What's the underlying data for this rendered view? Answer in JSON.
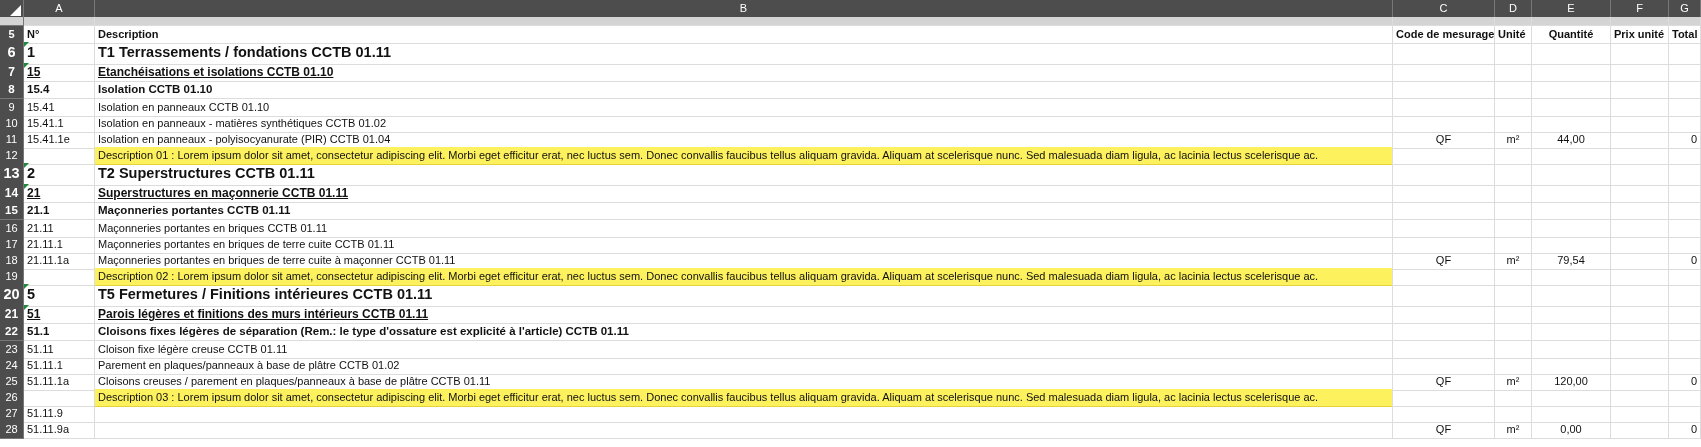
{
  "columns": [
    {
      "letter": "A"
    },
    {
      "letter": "B"
    },
    {
      "letter": "C"
    },
    {
      "letter": "D"
    },
    {
      "letter": "E"
    },
    {
      "letter": "F"
    },
    {
      "letter": "G"
    }
  ],
  "rows": [
    {
      "kind": "spacer",
      "marked": false
    },
    {
      "number": "5",
      "kind": "header",
      "marked": false,
      "no": "N°",
      "description": "Description",
      "code": "Code de mesurage",
      "unit": "Unité",
      "quantity": "Quantité",
      "unit_price": "Prix unité",
      "total": "Total"
    },
    {
      "number": "6",
      "kind": "section",
      "marked": true,
      "no": "1",
      "description": "T1 Terrassements / fondations CCTB 01.11"
    },
    {
      "number": "7",
      "kind": "subsection",
      "marked": true,
      "no": "15",
      "description": "Etanchéisations et isolations CCTB 01.10"
    },
    {
      "number": "8",
      "kind": "group",
      "marked": false,
      "no": "15.4",
      "description": "Isolation CCTB 01.10"
    },
    {
      "number": "9",
      "kind": "item",
      "marked": false,
      "no": "15.41",
      "description": "Isolation en panneaux CCTB 01.10"
    },
    {
      "number": "10",
      "kind": "item",
      "marked": false,
      "no": "15.41.1",
      "description": "Isolation en panneaux - matières synthétiques CCTB 01.02"
    },
    {
      "number": "11",
      "kind": "item",
      "marked": false,
      "no": "15.41.1e",
      "description": "Isolation en panneaux - polyisocyanurate (PIR) CCTB 01.04",
      "code": "QF",
      "unit": "m²",
      "quantity": "44,00",
      "total": "0"
    },
    {
      "number": "12",
      "kind": "description",
      "marked": false,
      "description": "Description 01 : Lorem ipsum dolor sit amet, consectetur adipiscing elit. Morbi eget efficitur erat, nec luctus sem. Donec convallis faucibus tellus aliquam gravida. Aliquam at scelerisque nunc. Sed malesuada diam ligula, ac lacinia lectus scelerisque ac."
    },
    {
      "number": "13",
      "kind": "section",
      "marked": true,
      "no": "2",
      "description": "T2 Superstructures CCTB 01.11"
    },
    {
      "number": "14",
      "kind": "subsection",
      "marked": true,
      "no": "21",
      "description": "Superstructures en maçonnerie CCTB 01.11"
    },
    {
      "number": "15",
      "kind": "group",
      "marked": false,
      "no": "21.1",
      "description": "Maçonneries portantes CCTB 01.11"
    },
    {
      "number": "16",
      "kind": "item",
      "marked": false,
      "no": "21.11",
      "description": "Maçonneries portantes en briques CCTB 01.11"
    },
    {
      "number": "17",
      "kind": "item",
      "marked": false,
      "no": "21.11.1",
      "description": "Maçonneries portantes en briques de terre cuite CCTB 01.11"
    },
    {
      "number": "18",
      "kind": "item",
      "marked": false,
      "no": "21.11.1a",
      "description": "Maçonneries portantes en briques de terre cuite à maçonner CCTB 01.11",
      "code": "QF",
      "unit": "m²",
      "quantity": "79,54",
      "total": "0"
    },
    {
      "number": "19",
      "kind": "description",
      "marked": false,
      "description": "Description 02 : Lorem ipsum dolor sit amet, consectetur adipiscing elit. Morbi eget efficitur erat, nec luctus sem. Donec convallis faucibus tellus aliquam gravida. Aliquam at scelerisque nunc. Sed malesuada diam ligula, ac lacinia lectus scelerisque ac."
    },
    {
      "number": "20",
      "kind": "section",
      "marked": true,
      "no": "5",
      "description": "T5 Fermetures / Finitions intérieures CCTB 01.11"
    },
    {
      "number": "21",
      "kind": "subsection",
      "marked": true,
      "no": "51",
      "description": "Parois légères et finitions des murs intérieurs CCTB 01.11"
    },
    {
      "number": "22",
      "kind": "group",
      "marked": false,
      "no": "51.1",
      "description": "Cloisons fixes légères de séparation (Rem.: le type d'ossature est explicité à l'article) CCTB 01.11"
    },
    {
      "number": "23",
      "kind": "item",
      "marked": false,
      "no": "51.11",
      "description": "Cloison fixe légère creuse CCTB 01.11"
    },
    {
      "number": "24",
      "kind": "item",
      "marked": false,
      "no": "51.11.1",
      "description": "Parement en plaques/panneaux à base de plâtre CCTB 01.02"
    },
    {
      "number": "25",
      "kind": "item",
      "marked": false,
      "no": "51.11.1a",
      "description": "Cloisons creuses / parement en plaques/panneaux à base de plâtre CCTB 01.11",
      "code": "QF",
      "unit": "m²",
      "quantity": "120,00",
      "total": "0"
    },
    {
      "number": "26",
      "kind": "description",
      "marked": false,
      "description": "Description 03 : Lorem ipsum dolor sit amet, consectetur adipiscing elit. Morbi eget efficitur erat, nec luctus sem. Donec convallis faucibus tellus aliquam gravida. Aliquam at scelerisque nunc. Sed malesuada diam ligula, ac lacinia lectus scelerisque ac."
    },
    {
      "number": "27",
      "kind": "item",
      "marked": false,
      "no": "51.11.9"
    },
    {
      "number": "28",
      "kind": "item",
      "marked": false,
      "no": "51.11.9a",
      "code": "QF",
      "unit": "m²",
      "quantity": "0,00",
      "total": "0"
    }
  ]
}
